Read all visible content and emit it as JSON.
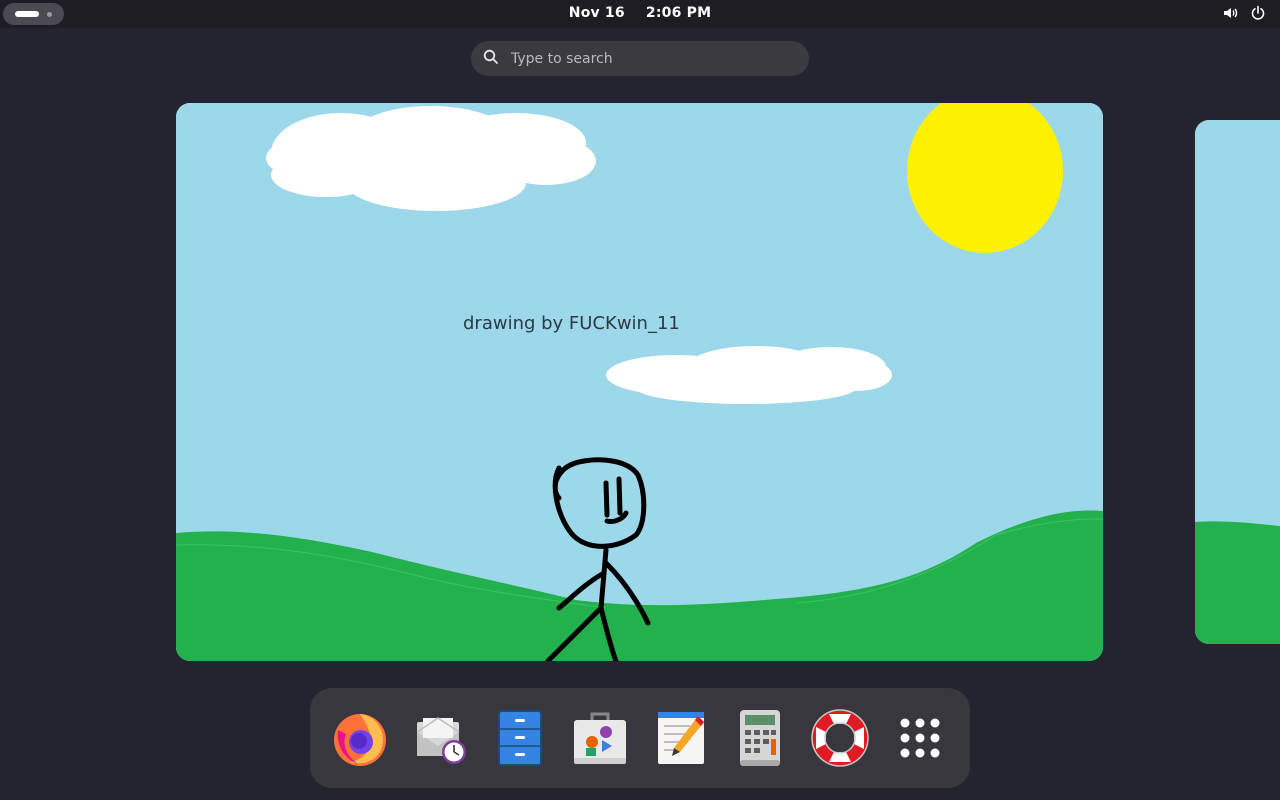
{
  "topbar": {
    "date": "Nov 16",
    "time": "2:06 PM"
  },
  "search": {
    "placeholder": "Type to search"
  },
  "workspace": {
    "drawing_caption": "drawing by FUCKwin_11"
  },
  "dock": {
    "apps": [
      {
        "name": "Firefox",
        "icon": "firefox-icon"
      },
      {
        "name": "Evolution",
        "icon": "mail-clock-icon"
      },
      {
        "name": "Files",
        "icon": "file-cabinet-icon"
      },
      {
        "name": "Software",
        "icon": "software-bag-icon"
      },
      {
        "name": "Text Editor",
        "icon": "text-editor-icon"
      },
      {
        "name": "Calculator",
        "icon": "calculator-icon"
      },
      {
        "name": "Help",
        "icon": "lifebuoy-icon"
      },
      {
        "name": "Show Applications",
        "icon": "app-grid-icon"
      }
    ]
  },
  "colors": {
    "sky": "#9dd8ea",
    "grass": "#22b14c",
    "sun": "#fff200",
    "panel": "#1d1d23",
    "dock": "#37373d"
  }
}
